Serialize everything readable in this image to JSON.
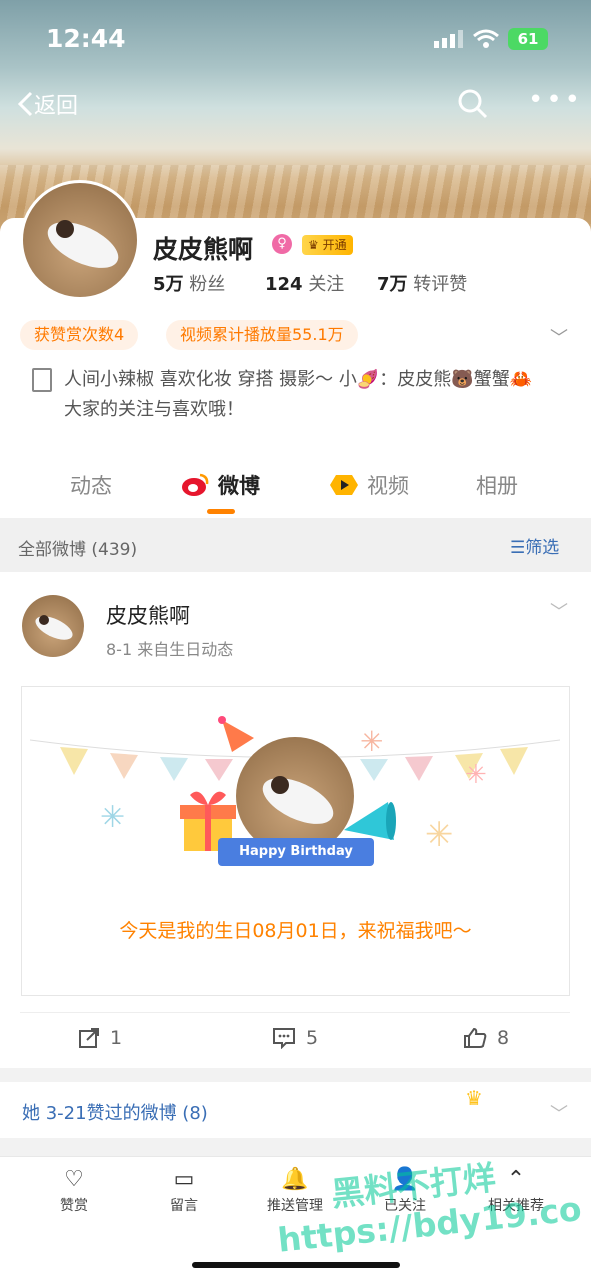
{
  "status_bar": {
    "time": "12:44",
    "battery": "61"
  },
  "nav": {
    "back_label": "返回"
  },
  "profile": {
    "name": "皮皮熊啊",
    "vip_label": "开通",
    "stats": [
      {
        "value": "5万",
        "label": "粉丝"
      },
      {
        "value": "124",
        "label": "关注"
      },
      {
        "value": "7万",
        "label": "转评赞"
      }
    ],
    "badges": [
      "获赞赏次数4",
      "视频累计播放量55.1万"
    ],
    "bio": "人间小辣椒 喜欢化妆 穿搭 摄影～ 小🍠：皮皮熊🐻蟹蟹🦀大家的关注与喜欢哦！"
  },
  "tabs": [
    "动态",
    "微博",
    "视频",
    "相册"
  ],
  "filter_bar": {
    "count_label": "全部微博 (439)",
    "filter_label": "筛选"
  },
  "post": {
    "author": "皮皮熊啊",
    "meta": "8-1  来自生日动态",
    "birthday_ribbon": "Happy Birthday",
    "birthday_text": "今天是我的生日08月01日，来祝福我吧～",
    "reposts": "1",
    "comments": "5",
    "likes": "8"
  },
  "liked_section": {
    "label": "她 3-21赞过的微博 (8)"
  },
  "bottom_bar": [
    {
      "label": "赞赏",
      "icon": "yen-heart-icon"
    },
    {
      "label": "留言",
      "icon": "message-icon"
    },
    {
      "label": "推送管理",
      "icon": "bell-plus-icon"
    },
    {
      "label": "已关注",
      "icon": "user-check-icon"
    },
    {
      "label": "相关推荐",
      "icon": "chevron-up-circle-icon"
    }
  ],
  "watermark": {
    "line1": "黑料不打烊",
    "line2": "https://bdy19.co"
  },
  "colors": {
    "accent": "#ff8200",
    "link": "#3a6eb5",
    "badge_bg": "#fff1e6"
  }
}
